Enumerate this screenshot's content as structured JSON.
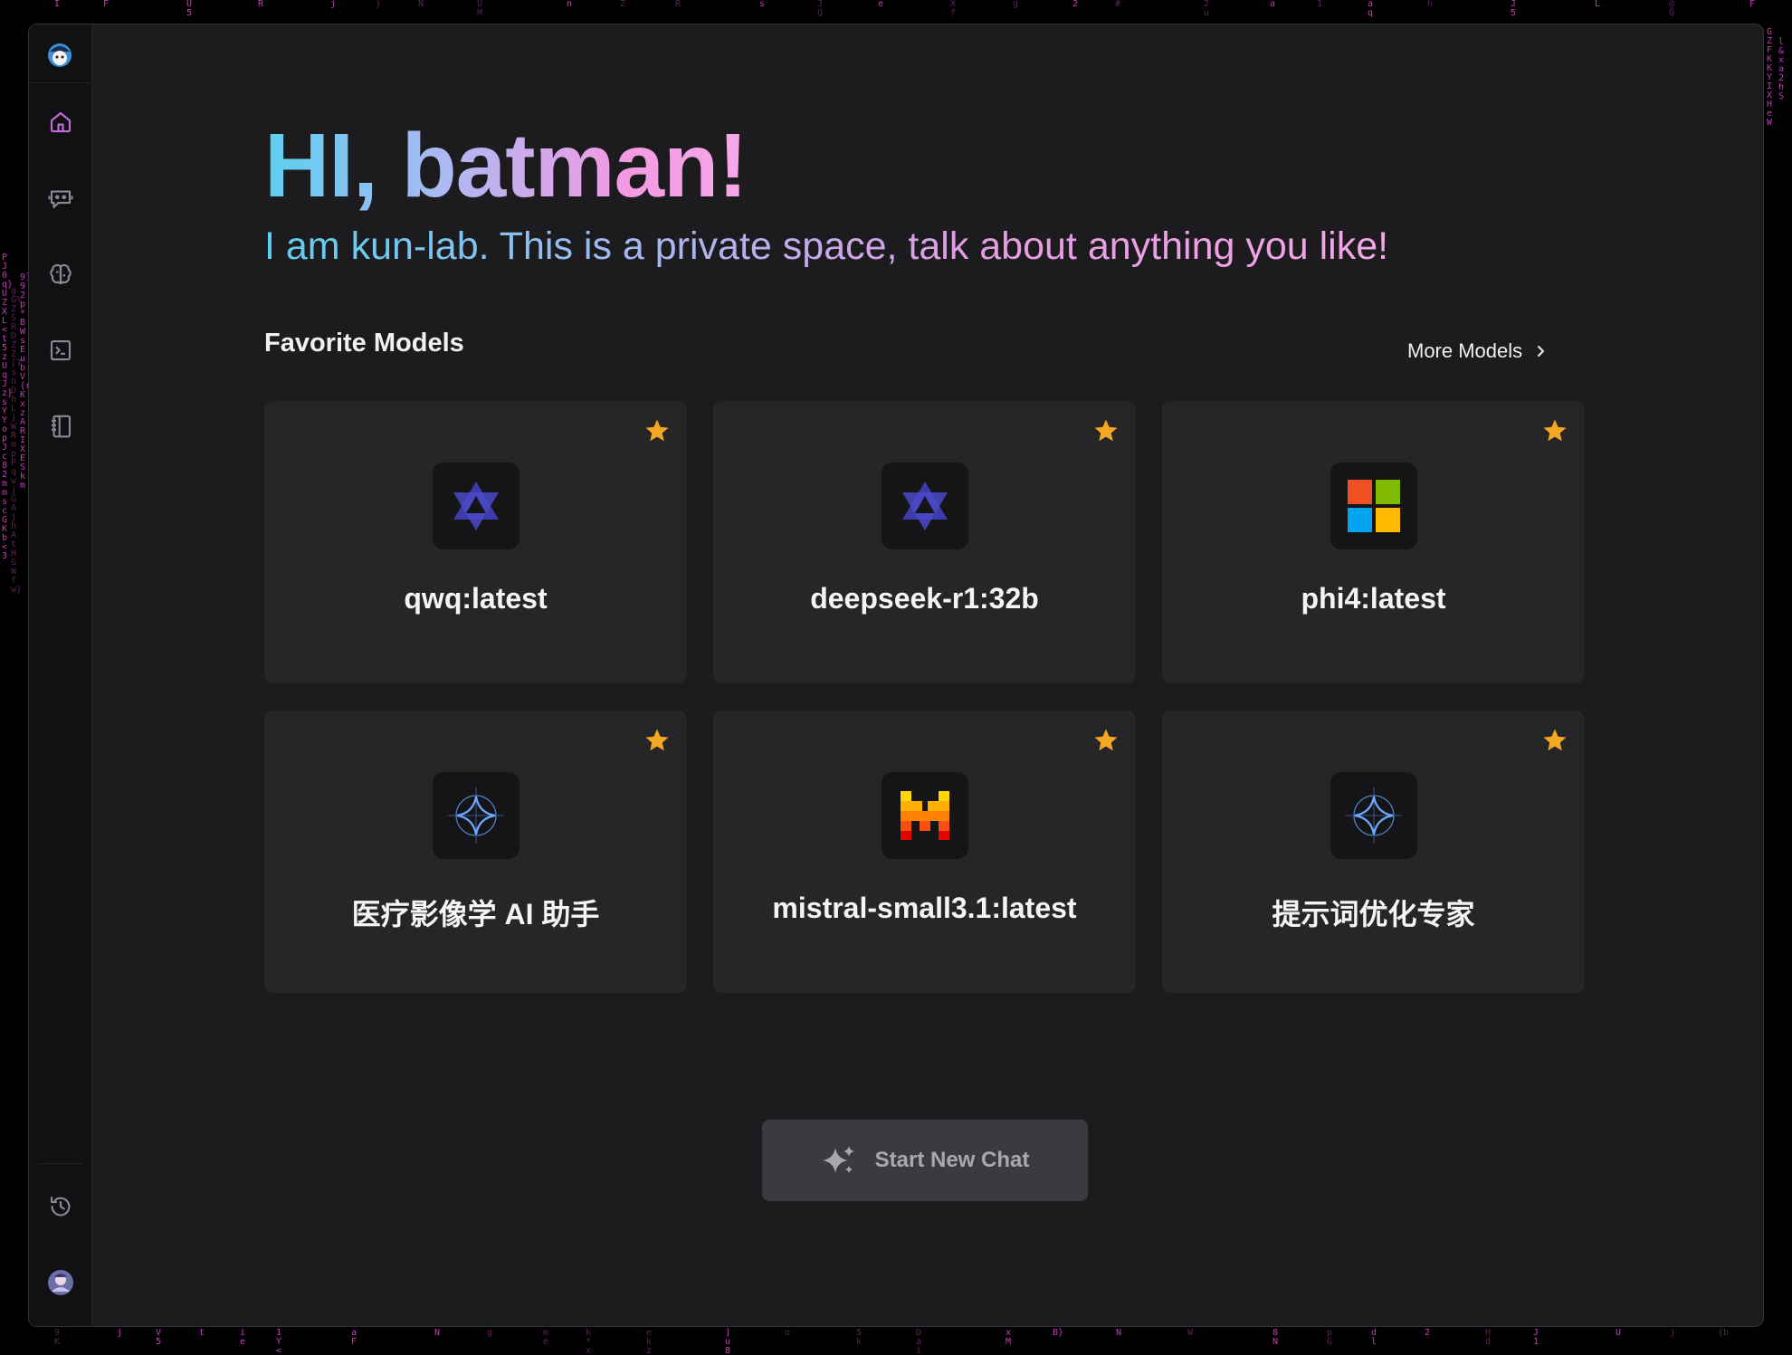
{
  "greeting": "HI, batman!",
  "subtitle": "I am kun-lab. This is a private space, talk about anything you like!",
  "favorites": {
    "title": "Favorite Models",
    "more_label": "More Models"
  },
  "models": [
    {
      "name": "qwq:latest",
      "icon": "qwen-icon",
      "favorited": true
    },
    {
      "name": "deepseek-r1:32b",
      "icon": "qwen-icon",
      "favorited": true
    },
    {
      "name": "phi4:latest",
      "icon": "microsoft-icon",
      "favorited": true
    },
    {
      "name": "医疗影像学 AI 助手",
      "icon": "sparkle-agent-icon",
      "favorited": true
    },
    {
      "name": "mistral-small3.1:latest",
      "icon": "mistral-icon",
      "favorited": true
    },
    {
      "name": "提示词优化专家",
      "icon": "sparkle-agent-icon",
      "favorited": true
    }
  ],
  "actions": {
    "new_chat": "Start New Chat"
  },
  "sidebar": {
    "items": [
      {
        "id": "home",
        "icon": "home-icon",
        "active": true
      },
      {
        "id": "chat",
        "icon": "bot-chat-icon"
      },
      {
        "id": "models",
        "icon": "brain-icon"
      },
      {
        "id": "terminal",
        "icon": "terminal-icon"
      },
      {
        "id": "notebook",
        "icon": "notebook-icon"
      },
      {
        "id": "history",
        "icon": "history-icon"
      },
      {
        "id": "profile",
        "icon": "avatar"
      }
    ]
  },
  "colors": {
    "accent": "#c26bdc",
    "star": "#f5a623",
    "card_bg": "#262628",
    "window_bg": "#1c1c1e"
  }
}
